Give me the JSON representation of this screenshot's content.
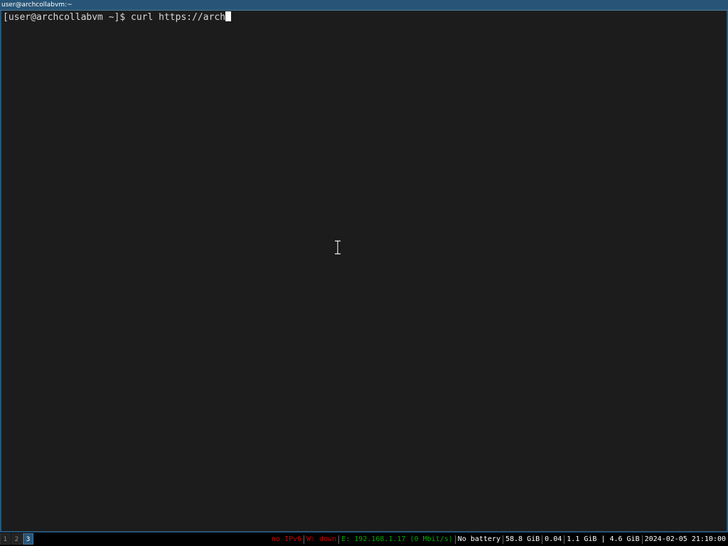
{
  "window": {
    "title": "user@archcollabvm:~"
  },
  "terminal": {
    "prompt": "[user@archcollabvm ~]$ ",
    "command": "curl https://arch"
  },
  "workspaces": [
    {
      "label": "1",
      "focused": false
    },
    {
      "label": "2",
      "focused": false
    },
    {
      "label": "3",
      "focused": true
    }
  ],
  "status": {
    "ipv6": "no IPv6",
    "wifi": "W: down",
    "ethernet": "E: 192.168.1.17 (0 Mbit/s)",
    "battery": "No battery",
    "disk": "58.8 GiB",
    "load": "0.04",
    "memory": "1.1 GiB | 4.6 GiB",
    "datetime": "2024-02-05 21:10:00"
  },
  "colors": {
    "focused_border": "#285577",
    "degraded": "#cc0000",
    "good": "#00aa00"
  }
}
